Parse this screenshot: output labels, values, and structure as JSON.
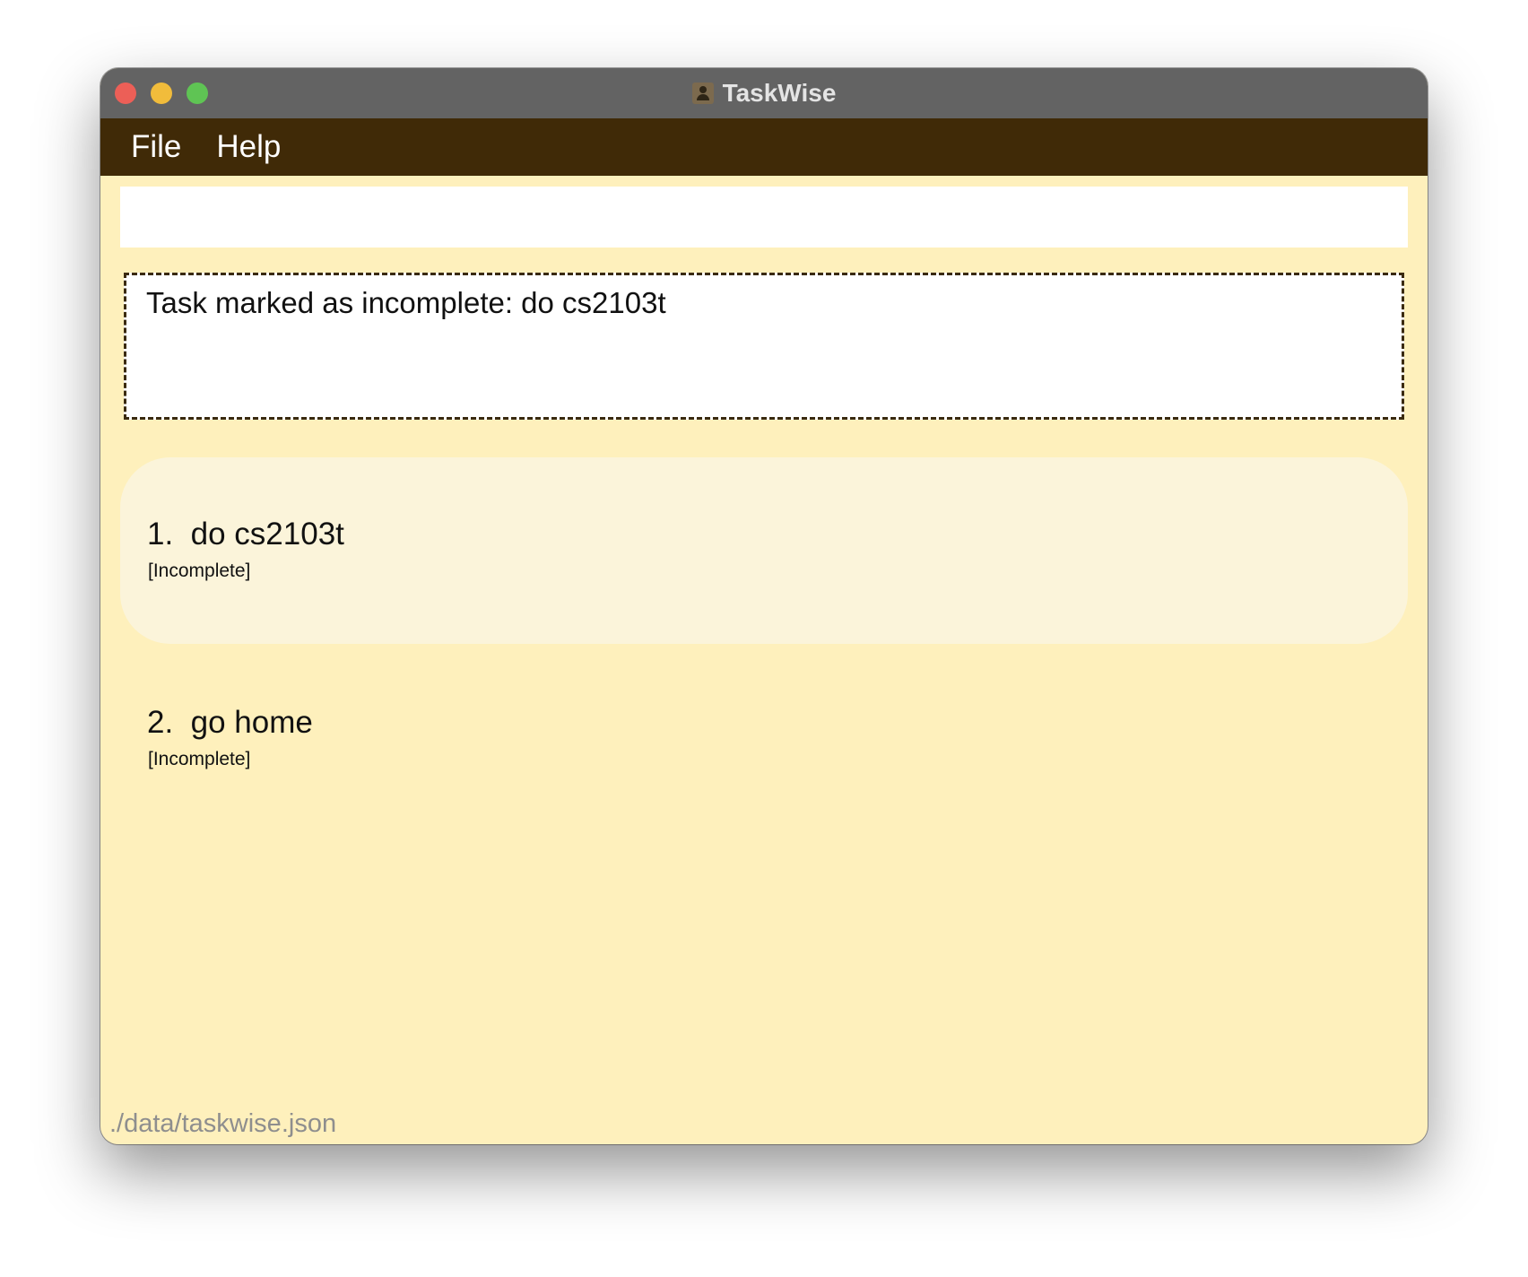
{
  "window": {
    "title": "TaskWise",
    "icon": "app-person-icon"
  },
  "menu": {
    "file": "File",
    "help": "Help"
  },
  "command": {
    "value": "",
    "placeholder": ""
  },
  "result": {
    "message": "Task marked as incomplete: do cs2103t"
  },
  "tasks": [
    {
      "index": "1.",
      "name": "do cs2103t",
      "status": "[Incomplete]",
      "selected": true
    },
    {
      "index": "2.",
      "name": "go home",
      "status": "[Incomplete]",
      "selected": false
    }
  ],
  "status_bar": {
    "path": "./data/taskwise.json"
  },
  "colors": {
    "menubar": "#402a07",
    "background": "#fef0bc",
    "selected_card": "#fbf4da"
  }
}
